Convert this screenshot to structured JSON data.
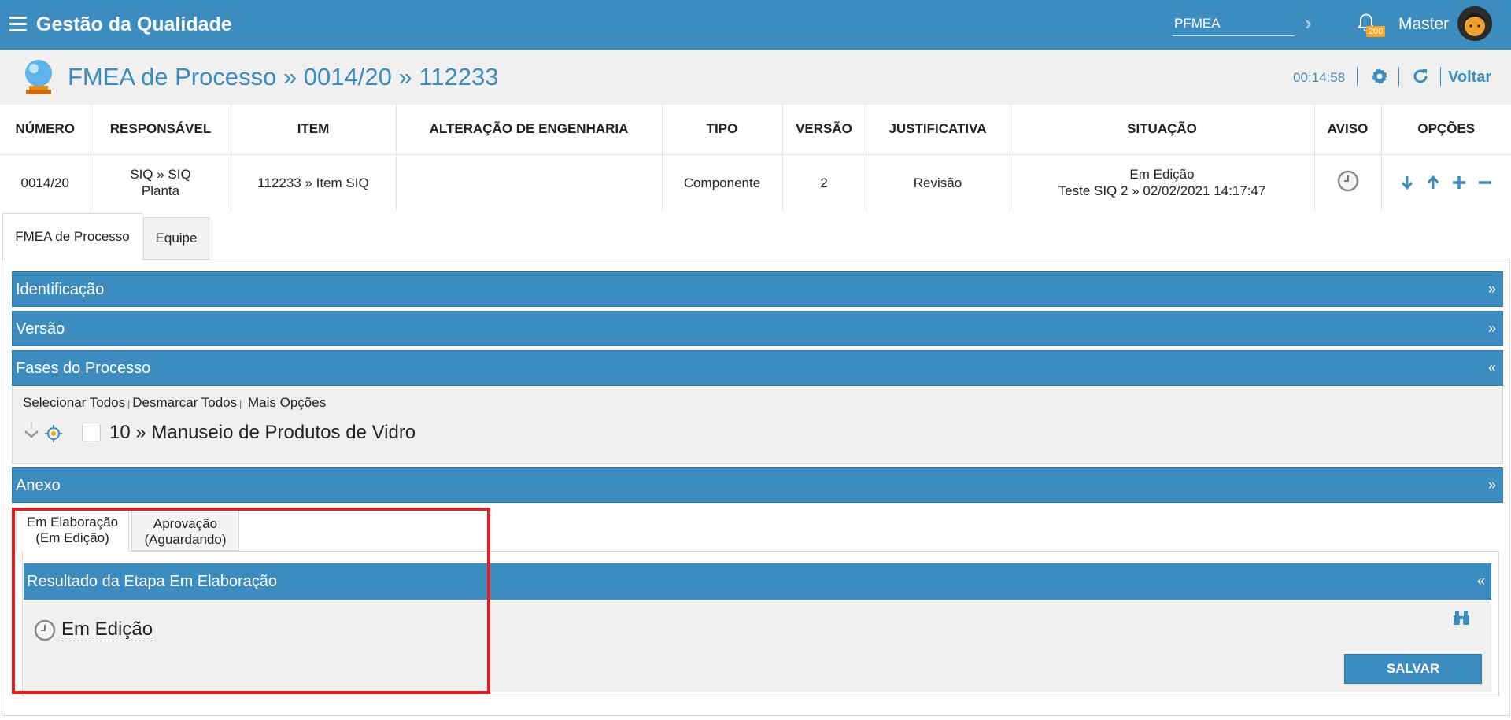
{
  "app": {
    "title": "Gestão da Qualidade"
  },
  "search": {
    "value": "PFMEA"
  },
  "notifications": {
    "count": "200"
  },
  "user": {
    "name": "Master"
  },
  "page": {
    "title": "FMEA de Processo » 0014/20 » 112233",
    "timer": "00:14:58",
    "back_label": "Voltar"
  },
  "table": {
    "headers": [
      "NÚMERO",
      "RESPONSÁVEL",
      "ITEM",
      "ALTERAÇÃO DE ENGENHARIA",
      "TIPO",
      "VERSÃO",
      "JUSTIFICATIVA",
      "SITUAÇÃO",
      "AVISO",
      "OPÇÕES"
    ],
    "row": {
      "numero": "0014/20",
      "responsavel_line1": "SIQ » SIQ",
      "responsavel_line2": "Planta",
      "item": "112233 » Item SIQ",
      "alteracao": "",
      "tipo": "Componente",
      "versao": "2",
      "justificativa": "Revisão",
      "situacao_line1": "Em Edição",
      "situacao_line2": "Teste SIQ 2 » 02/02/2021 14:17:47"
    }
  },
  "tabs": [
    "FMEA de Processo",
    "Equipe"
  ],
  "sections": {
    "identificacao": "Identificação",
    "versao": "Versão",
    "fases": "Fases do Processo",
    "anexo": "Anexo",
    "collapsed_chevron": "»",
    "expanded_chevron": "«"
  },
  "fases": {
    "select_all": "Selecionar Todos",
    "deselect_all": "Desmarcar Todos",
    "more_options": "Mais Opções",
    "separator": "|",
    "node": "10 » Manuseio de Produtos de Vidro"
  },
  "workflow_tabs": [
    {
      "line1": "Em Elaboração",
      "line2": "(Em Edição)"
    },
    {
      "line1": "Aprovação",
      "line2": "(Aguardando)"
    }
  ],
  "result": {
    "title": "Resultado da Etapa Em Elaboração",
    "status": "Em Edição",
    "save_label": "SALVAR"
  },
  "colors": {
    "primary": "#3d8cbf",
    "badge": "#f5a623",
    "highlight": "#e02020"
  }
}
